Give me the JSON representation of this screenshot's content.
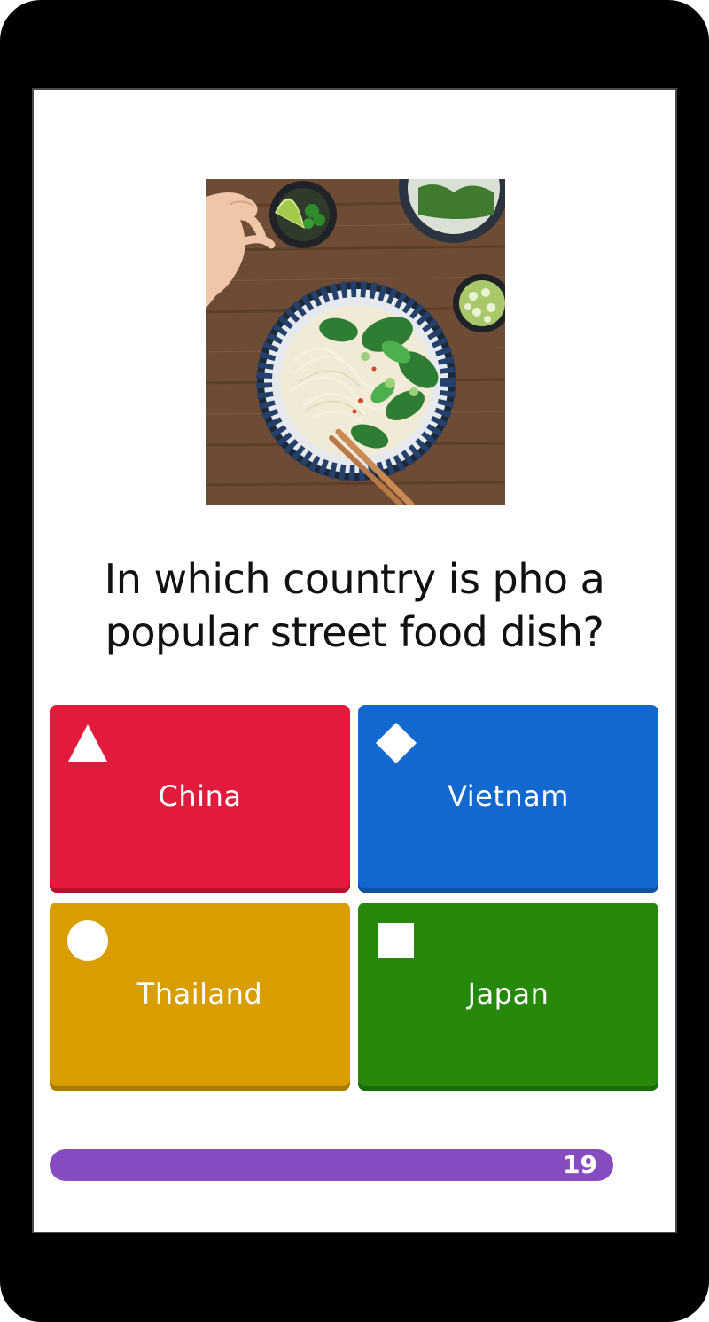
{
  "question": {
    "text": "In which country is pho a popular street food dish?",
    "image": "pho-noodle-soup-photo"
  },
  "answers": [
    {
      "label": "China",
      "shape": "triangle-icon",
      "color": "#e21b3c"
    },
    {
      "label": "Vietnam",
      "shape": "diamond-icon",
      "color": "#1368ce"
    },
    {
      "label": "Thailand",
      "shape": "circle-icon",
      "color": "#d89e00"
    },
    {
      "label": "Japan",
      "shape": "square-icon",
      "color": "#26890c"
    }
  ],
  "timer": {
    "count": "19",
    "progress": 1.0,
    "color": "#864cbf"
  }
}
